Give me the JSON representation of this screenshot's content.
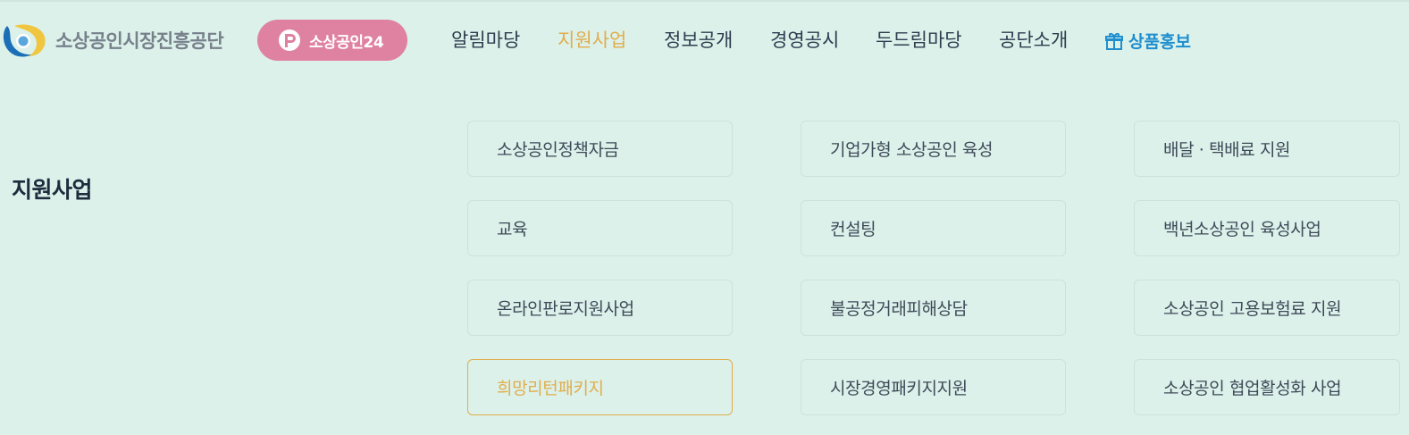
{
  "brand": {
    "name": "소상공인시장진흥공단"
  },
  "badge": {
    "label": "소상공인24",
    "icon": "p-circle-icon"
  },
  "nav": {
    "items": [
      {
        "label": "알림마당"
      },
      {
        "label": "지원사업",
        "active": true
      },
      {
        "label": "정보공개"
      },
      {
        "label": "경영공시"
      },
      {
        "label": "두드림마당"
      },
      {
        "label": "공단소개"
      },
      {
        "label": "상품홍보",
        "icon": "gift-icon"
      }
    ]
  },
  "section": {
    "title": "지원사업"
  },
  "menu": {
    "items": [
      {
        "label": "소상공인정책자금"
      },
      {
        "label": "기업가형 소상공인 육성"
      },
      {
        "label": "배달 · 택배료 지원"
      },
      {
        "label": "교육"
      },
      {
        "label": "컨설팅"
      },
      {
        "label": "백년소상공인 육성사업"
      },
      {
        "label": "온라인판로지원사업"
      },
      {
        "label": "불공정거래피해상담"
      },
      {
        "label": "소상공인 고용보험료 지원"
      },
      {
        "label": "희망리턴패키지",
        "active": true
      },
      {
        "label": "시장경영패키지지원"
      },
      {
        "label": "소상공인 협업활성화 사업"
      }
    ]
  },
  "colors": {
    "background": "#dcf1ea",
    "accent": "#e1ad4c",
    "badge": "#df81a0",
    "promo": "#1f8fcf",
    "text": "#2e3d4f"
  }
}
